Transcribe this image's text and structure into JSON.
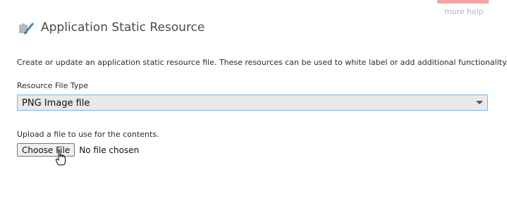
{
  "header": {
    "more_help": "more help",
    "title": "Application Static Resource",
    "title_icon": "puzzle-brush-icon",
    "help_tab_color": "#f4a6a6"
  },
  "form": {
    "description": "Create or update an application static resource file. These resources can be used to white label or add additional functionality.",
    "resource_type": {
      "label": "Resource File Type",
      "selected": "PNG Image file",
      "border_color": "#7eb4ea"
    },
    "upload": {
      "label": "Upload a file to use for the contents.",
      "button": "Choose File",
      "status": "No file chosen"
    }
  },
  "cursor": {
    "icon": "hand-pointer-cursor-icon"
  }
}
